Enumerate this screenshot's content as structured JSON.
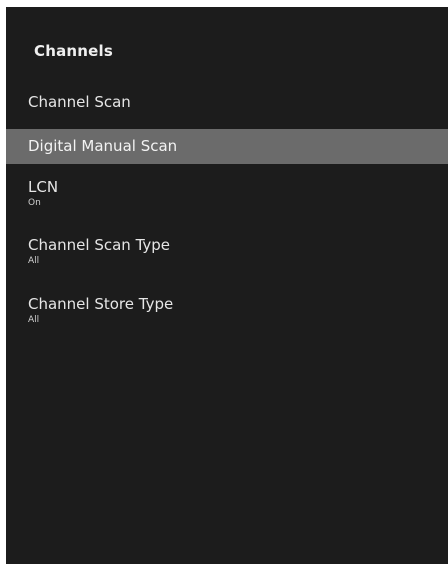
{
  "panel": {
    "title": "Channels",
    "background_color": "#1c1c1c",
    "selected_color": "#6b6b6b"
  },
  "menu": {
    "items": [
      {
        "label": "Channel Scan",
        "value": "",
        "selected": false
      },
      {
        "label": "Digital Manual Scan",
        "value": "",
        "selected": true
      },
      {
        "label": "LCN",
        "value": "On",
        "selected": false
      },
      {
        "label": "Channel Scan Type",
        "value": "All",
        "selected": false
      },
      {
        "label": "Channel Store Type",
        "value": "All",
        "selected": false
      }
    ]
  }
}
